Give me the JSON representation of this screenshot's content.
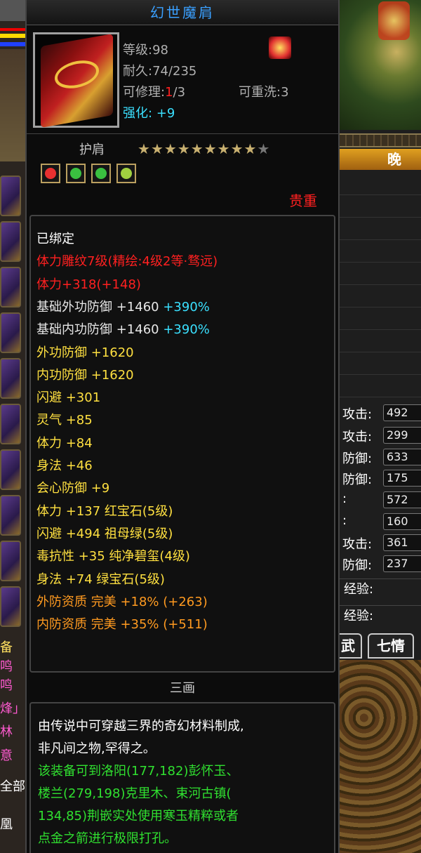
{
  "left_strip": {
    "lines": [
      {
        "text": "备",
        "color": "#ffe060"
      },
      {
        "text": "鸣",
        "color": "#ff5ad0"
      },
      {
        "text": "鸣",
        "color": "#ff5ad0"
      },
      {
        "text": "烽」",
        "color": "#ff5ad0"
      },
      {
        "text": "林",
        "color": "#ff5ad0"
      },
      {
        "text": "意",
        "color": "#ff5ad0"
      },
      {
        "text": "全部",
        "color": "#ffffff"
      },
      {
        "text": "凰",
        "color": "#ffffff"
      }
    ]
  },
  "right_panel": {
    "evening_tab": "晚",
    "stats": [
      {
        "label": "攻击:",
        "value": "492"
      },
      {
        "label": "攻击:",
        "value": "299"
      },
      {
        "label": "防御:",
        "value": "633"
      },
      {
        "label": "防御:",
        "value": "175"
      },
      {
        "label": ":",
        "value": "572"
      },
      {
        "label": ":",
        "value": "160"
      },
      {
        "label": "攻击:",
        "value": "361"
      },
      {
        "label": "防御:",
        "value": "237"
      }
    ],
    "exp1": "经验:",
    "exp2": "经验:",
    "tab_martial": "武",
    "tab_emotions": "七情"
  },
  "tooltip": {
    "title": "幻世魔肩",
    "level": "等级:98",
    "durability": "耐久:74/235",
    "repairable_label": "可修理:",
    "repairable_used": "1",
    "repairable_total": "/3",
    "rewashable": "可重洗:3",
    "enhance_label": "强化:",
    "enhance_value": "+9",
    "slot": "护肩",
    "stars_total": 10,
    "stars_filled": 9,
    "gem_colors": [
      "#e83030",
      "#3ac040",
      "#3ac040",
      "#a0d040"
    ],
    "rarity": "贵重",
    "attributes": [
      {
        "text": "已绑定",
        "color": "#ffffff"
      },
      {
        "text": "体力雕纹7级(精绘:4级2等·骛远)",
        "color": "#ff2020"
      },
      {
        "text": "体力+318(+148)",
        "color": "#ff2020"
      },
      {
        "text": "基础外功防御 +1460",
        "extra": " +390%",
        "color": "#e8e8e8"
      },
      {
        "text": "基础内功防御 +1460",
        "extra": " +390%",
        "color": "#e8e8e8"
      },
      {
        "text": "外功防御 +1620",
        "color": "#ffe040"
      },
      {
        "text": "内功防御 +1620",
        "color": "#ffe040"
      },
      {
        "text": "闪避 +301",
        "color": "#ffe040"
      },
      {
        "text": "灵气 +85",
        "color": "#ffe040"
      },
      {
        "text": "体力 +84",
        "color": "#ffe040"
      },
      {
        "text": "身法 +46",
        "color": "#ffe040"
      },
      {
        "text": "会心防御 +9",
        "color": "#ffe040"
      },
      {
        "text": "体力 +137 红宝石(5级)",
        "color": "#ffe040"
      },
      {
        "text": "闪避 +494 祖母绿(5级)",
        "color": "#ffe040"
      },
      {
        "text": "毒抗性 +35 纯净碧玺(4级)",
        "color": "#ffe040"
      },
      {
        "text": "身法 +74 绿宝石(5级)",
        "color": "#ffe040"
      },
      {
        "text": "外防资质  完美 +18% (+263)",
        "color": "#ff9a20"
      },
      {
        "text": "内防资质  完美 +35% (+511)",
        "color": "#ff9a20"
      }
    ],
    "section_label": "三画",
    "description": [
      {
        "text": "由传说中可穿越三界的奇幻材料制成,",
        "color": "#ffffff"
      },
      {
        "text": "非凡间之物,罕得之。",
        "color": "#ffffff"
      },
      {
        "text": "该装备可到洛阳(177,182)彭怀玉、",
        "color": "#30e030"
      },
      {
        "text": "楼兰(279,198)克里木、束河古镇(",
        "color": "#30e030"
      },
      {
        "text": "134,85)荆嵌实处使用寒玉精粹或者",
        "color": "#30e030"
      },
      {
        "text": "点金之箭进行极限打孔。",
        "color": "#30e030"
      }
    ]
  }
}
